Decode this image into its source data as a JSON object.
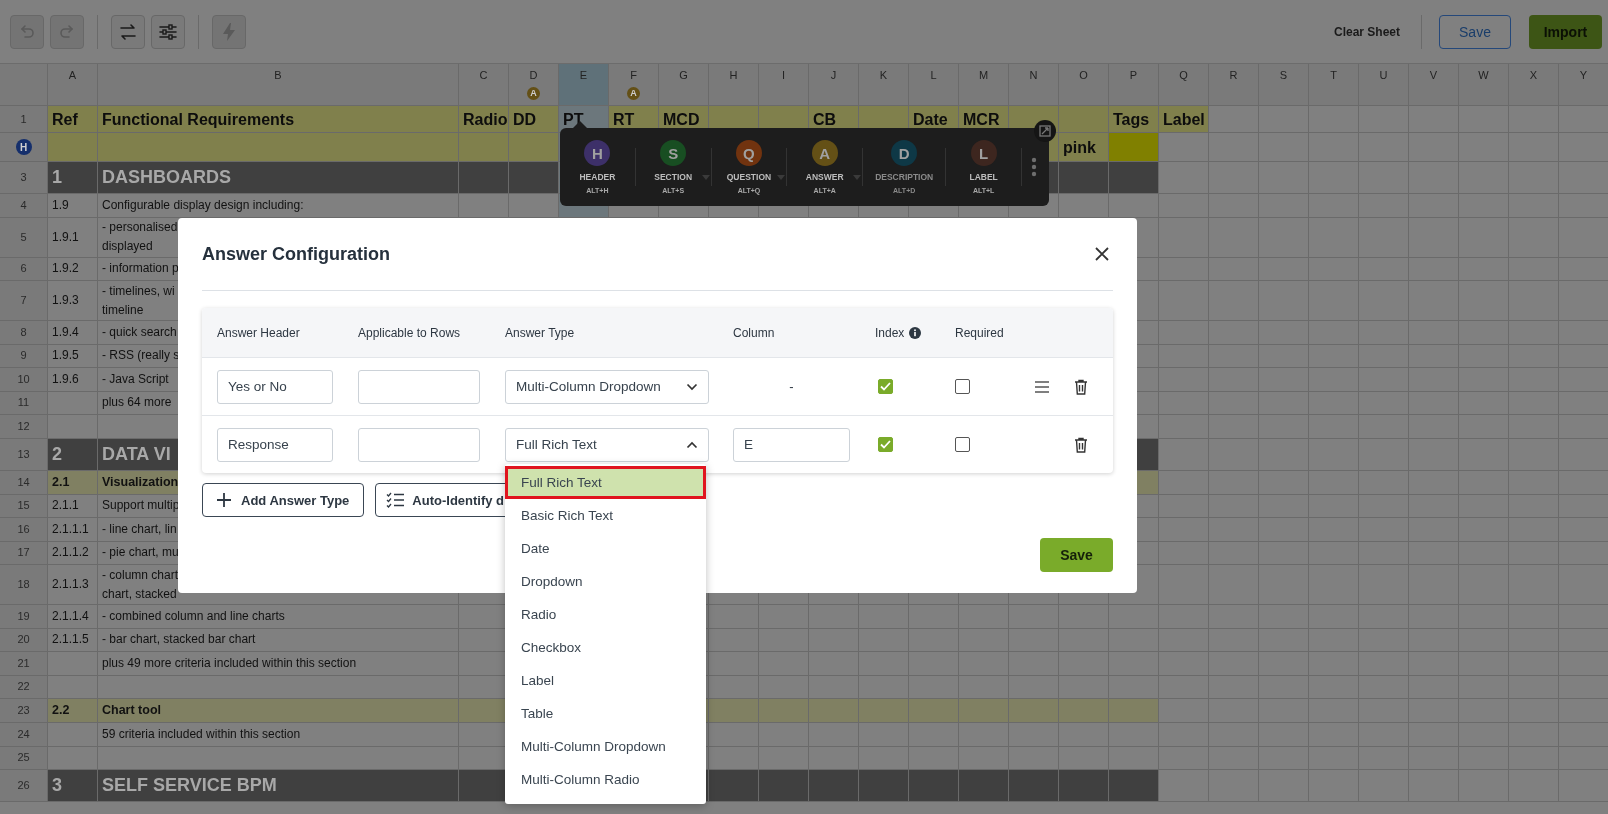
{
  "toolbar": {
    "groups": [
      [
        {
          "kind": "undo",
          "disabled": true
        },
        {
          "kind": "redo",
          "disabled": true
        }
      ],
      [
        {
          "kind": "swap",
          "disabled": false
        },
        {
          "kind": "sliders",
          "disabled": false
        }
      ],
      [
        {
          "kind": "lightning",
          "disabled": true
        }
      ]
    ],
    "clear_sheet": "Clear Sheet",
    "save": "Save",
    "import": "Import"
  },
  "sheet": {
    "columns": [
      {
        "label": "A",
        "selected": false
      },
      {
        "label": "B",
        "selected": false
      },
      {
        "label": "C",
        "selected": false
      },
      {
        "label": "D",
        "selected": false,
        "badge": "A"
      },
      {
        "label": "E",
        "selected": true
      },
      {
        "label": "F",
        "selected": false,
        "badge": "A"
      },
      {
        "label": "G",
        "selected": false
      },
      {
        "label": "H",
        "selected": false
      },
      {
        "label": "I",
        "selected": false
      },
      {
        "label": "J",
        "selected": false
      },
      {
        "label": "K",
        "selected": false
      },
      {
        "label": "L",
        "selected": false
      },
      {
        "label": "M",
        "selected": false
      },
      {
        "label": "N",
        "selected": false
      },
      {
        "label": "O",
        "selected": false
      },
      {
        "label": "P",
        "selected": false
      },
      {
        "label": "Q",
        "selected": false
      },
      {
        "label": "R",
        "selected": false
      },
      {
        "label": "S",
        "selected": false
      },
      {
        "label": "T",
        "selected": false
      },
      {
        "label": "U",
        "selected": false
      },
      {
        "label": "V",
        "selected": false
      },
      {
        "label": "W",
        "selected": false
      },
      {
        "label": "X",
        "selected": false
      },
      {
        "label": "Y",
        "selected": false
      }
    ],
    "rows": [
      {
        "number": "1",
        "kind": "header",
        "cells": [
          "Ref",
          "Functional Requirements",
          "Radio",
          "DD",
          "PT",
          "RT",
          "MCD",
          "",
          "",
          "CB",
          "",
          "Date",
          "MCR",
          "",
          "",
          "Tags",
          "Label"
        ]
      },
      {
        "badge": "H",
        "kind": "subheader",
        "cells": [
          "",
          "",
          "",
          "",
          "",
          "",
          "",
          "",
          "",
          "",
          "",
          "",
          "",
          "",
          "pink",
          {
            "color": "#808000"
          }
        ]
      },
      {
        "number": "3",
        "kind": "section",
        "cells": [
          "1",
          "DASHBOARDS"
        ]
      },
      {
        "number": "4",
        "kind": "plain",
        "cells": [
          "1.9",
          "Configurable display design including:"
        ]
      },
      {
        "number": "5",
        "kind": "plain",
        "cells": [
          "1.9.1",
          "- personalised\ndisplayed"
        ]
      },
      {
        "number": "6",
        "kind": "plain",
        "cells": [
          "1.9.2",
          "- information p"
        ]
      },
      {
        "number": "7",
        "kind": "plain",
        "cells": [
          "1.9.3",
          "- timelines, wi\ntimeline"
        ]
      },
      {
        "number": "8",
        "kind": "plain",
        "cells": [
          "1.9.4",
          "- quick search"
        ]
      },
      {
        "number": "9",
        "kind": "plain",
        "cells": [
          "1.9.5",
          "- RSS (really s"
        ]
      },
      {
        "number": "10",
        "kind": "plain",
        "cells": [
          "1.9.6",
          "- Java Script"
        ]
      },
      {
        "number": "11",
        "kind": "plain",
        "cells": [
          "",
          "plus 64 more"
        ]
      },
      {
        "number": "12",
        "kind": "plain"
      },
      {
        "number": "13",
        "kind": "section",
        "cells": [
          "2",
          "DATA VI"
        ]
      },
      {
        "number": "14",
        "kind": "subsection",
        "cells": [
          "2.1",
          "Visualization"
        ]
      },
      {
        "number": "15",
        "kind": "plain",
        "cells": [
          "2.1.1",
          "Support multip"
        ]
      },
      {
        "number": "16",
        "kind": "plain",
        "cells": [
          "2.1.1.1",
          "- line chart, lin"
        ]
      },
      {
        "number": "17",
        "kind": "plain",
        "cells": [
          "2.1.1.2",
          "- pie chart, mu"
        ]
      },
      {
        "number": "18",
        "kind": "plain",
        "cells": [
          "2.1.1.3",
          "- column chart\nchart, stacked"
        ]
      },
      {
        "number": "19",
        "kind": "plain",
        "cells": [
          "2.1.1.4",
          "- combined column and line charts"
        ]
      },
      {
        "number": "20",
        "kind": "plain",
        "cells": [
          "2.1.1.5",
          "- bar chart, stacked bar chart"
        ]
      },
      {
        "number": "21",
        "kind": "plain",
        "cells": [
          "",
          "plus 49 more criteria included within this section"
        ]
      },
      {
        "number": "22",
        "kind": "plain"
      },
      {
        "number": "23",
        "kind": "subsection",
        "cells": [
          "2.2",
          "Chart tool"
        ]
      },
      {
        "number": "24",
        "kind": "plain",
        "cells": [
          "",
          "59 criteria included within this section"
        ]
      },
      {
        "number": "25",
        "kind": "plain"
      },
      {
        "number": "26",
        "kind": "section",
        "cells": [
          "3",
          "SELF SERVICE BPM"
        ]
      }
    ]
  },
  "quick_toolbar": {
    "items": [
      {
        "letter": "H",
        "label": "HEADER",
        "shortcut": "ALT+H",
        "color": "#3d3069",
        "disabled": false,
        "has_menu": false
      },
      {
        "letter": "S",
        "label": "SECTION",
        "shortcut": "ALT+S",
        "color": "#184e22",
        "disabled": false,
        "has_menu": true
      },
      {
        "letter": "Q",
        "label": "QUESTION",
        "shortcut": "ALT+Q",
        "color": "#71330f",
        "disabled": false,
        "has_menu": true
      },
      {
        "letter": "A",
        "label": "ANSWER",
        "shortcut": "ALT+A",
        "color": "#645016",
        "disabled": false,
        "has_menu": true
      },
      {
        "letter": "D",
        "label": "DESCRIPTION",
        "shortcut": "ALT+D",
        "color": "#0e3846",
        "disabled": true,
        "has_menu": false
      },
      {
        "letter": "L",
        "label": "LABEL",
        "shortcut": "ALT+L",
        "color": "#3d261f",
        "disabled": false,
        "has_menu": false
      }
    ]
  },
  "dialog": {
    "title": "Answer Configuration",
    "columns": [
      {
        "label": "Answer Header",
        "info": false
      },
      {
        "label": "Applicable to Rows",
        "info": false
      },
      {
        "label": "Answer Type",
        "info": false
      },
      {
        "label": "Column",
        "info": false
      },
      {
        "label": "Index",
        "info": true
      },
      {
        "label": "Required",
        "info": false
      }
    ],
    "rows": [
      {
        "answer_header": "Yes or No",
        "answer_type": "Multi-Column Dropdown",
        "open": false,
        "column": {
          "kind": "text",
          "value": "-"
        },
        "index": true,
        "required": false,
        "reorder": true
      },
      {
        "answer_header": "Response",
        "answer_type": "Full Rich Text",
        "open": true,
        "column": {
          "kind": "field",
          "value": "E"
        },
        "index": true,
        "required": false,
        "reorder": false
      }
    ],
    "add_button": "Add Answer Type",
    "auto_button": "Auto-Identify d",
    "save_button": "Save",
    "dropdown": {
      "options": [
        {
          "label": "Full Rich Text",
          "selected": true,
          "outlined": true
        },
        {
          "label": "Basic Rich Text",
          "selected": false,
          "outlined": false
        },
        {
          "label": "Date",
          "selected": false,
          "outlined": false
        },
        {
          "label": "Dropdown",
          "selected": false,
          "outlined": false
        },
        {
          "label": "Radio",
          "selected": false,
          "outlined": false
        },
        {
          "label": "Checkbox",
          "selected": false,
          "outlined": false
        },
        {
          "label": "Label",
          "selected": false,
          "outlined": false
        },
        {
          "label": "Table",
          "selected": false,
          "outlined": false
        },
        {
          "label": "Multi-Column Dropdown",
          "selected": false,
          "outlined": false
        },
        {
          "label": "Multi-Column Radio",
          "selected": false,
          "outlined": false
        }
      ]
    }
  }
}
